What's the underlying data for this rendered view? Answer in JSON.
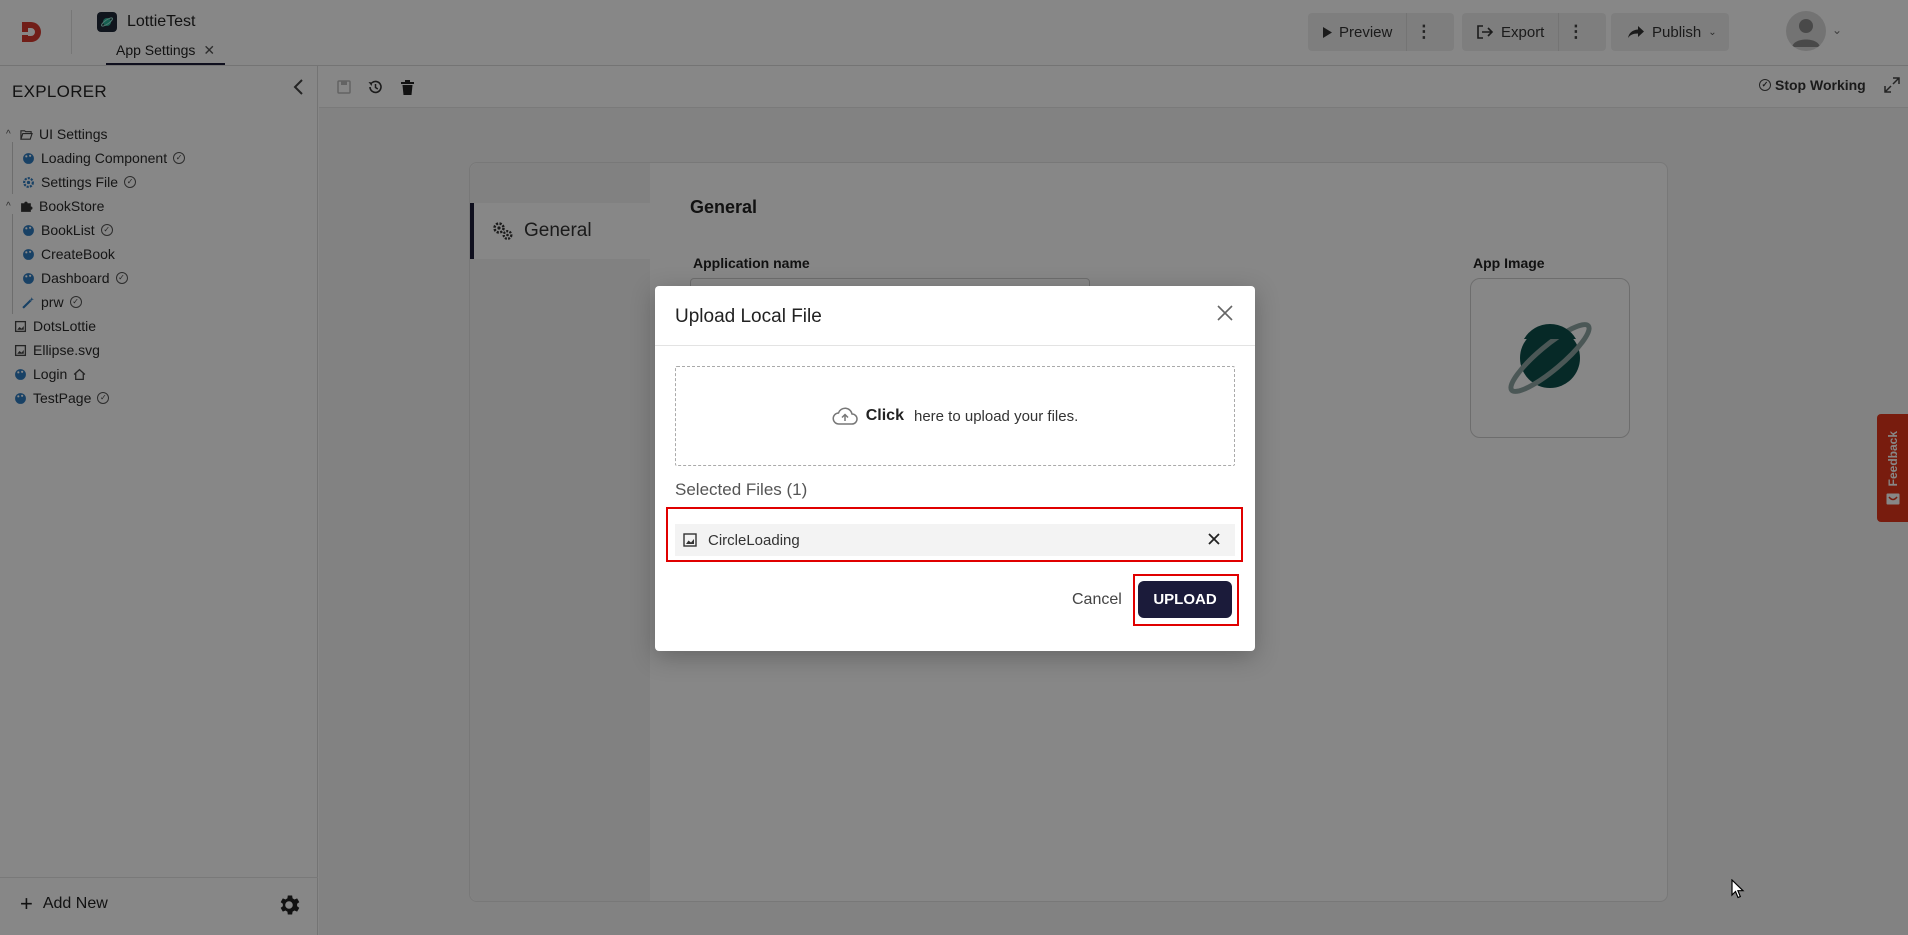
{
  "header": {
    "app_name": "LottieTest",
    "tab_label": "App Settings",
    "tab_close": "✕",
    "preview_label": "Preview",
    "export_label": "Export",
    "publish_label": "Publish",
    "more_glyph": "⋮"
  },
  "sidebar": {
    "title": "EXPLORER",
    "collapse_glyph": "<",
    "items": [
      {
        "label": "UI Settings"
      },
      {
        "label": "Loading Component"
      },
      {
        "label": "Settings File"
      },
      {
        "label": "BookStore"
      },
      {
        "label": "BookList"
      },
      {
        "label": "CreateBook"
      },
      {
        "label": "Dashboard"
      },
      {
        "label": "prw"
      },
      {
        "label": "DotsLottie"
      },
      {
        "label": "Ellipse.svg"
      },
      {
        "label": "Login"
      },
      {
        "label": "TestPage"
      }
    ],
    "add_new_label": "Add New"
  },
  "toolbar": {
    "stop_working_label": "Stop Working"
  },
  "settings": {
    "nav_general_label": "General",
    "section_title": "General",
    "app_name_label": "Application name",
    "app_image_label": "App Image"
  },
  "feedback": {
    "label": "Feedback"
  },
  "modal": {
    "title": "Upload Local File",
    "dropzone_click": "Click",
    "dropzone_text": "here to upload your files.",
    "selected_files_label": "Selected Files (1)",
    "files": [
      {
        "name": "CircleLoading"
      }
    ],
    "cancel_label": "Cancel",
    "upload_label": "UPLOAD"
  },
  "colors": {
    "primary": "#1b1b3a",
    "highlight": "#e00000",
    "feedback": "#e2361c",
    "brand_red": "#d63a2f",
    "app_image": "#0c4f4a"
  }
}
